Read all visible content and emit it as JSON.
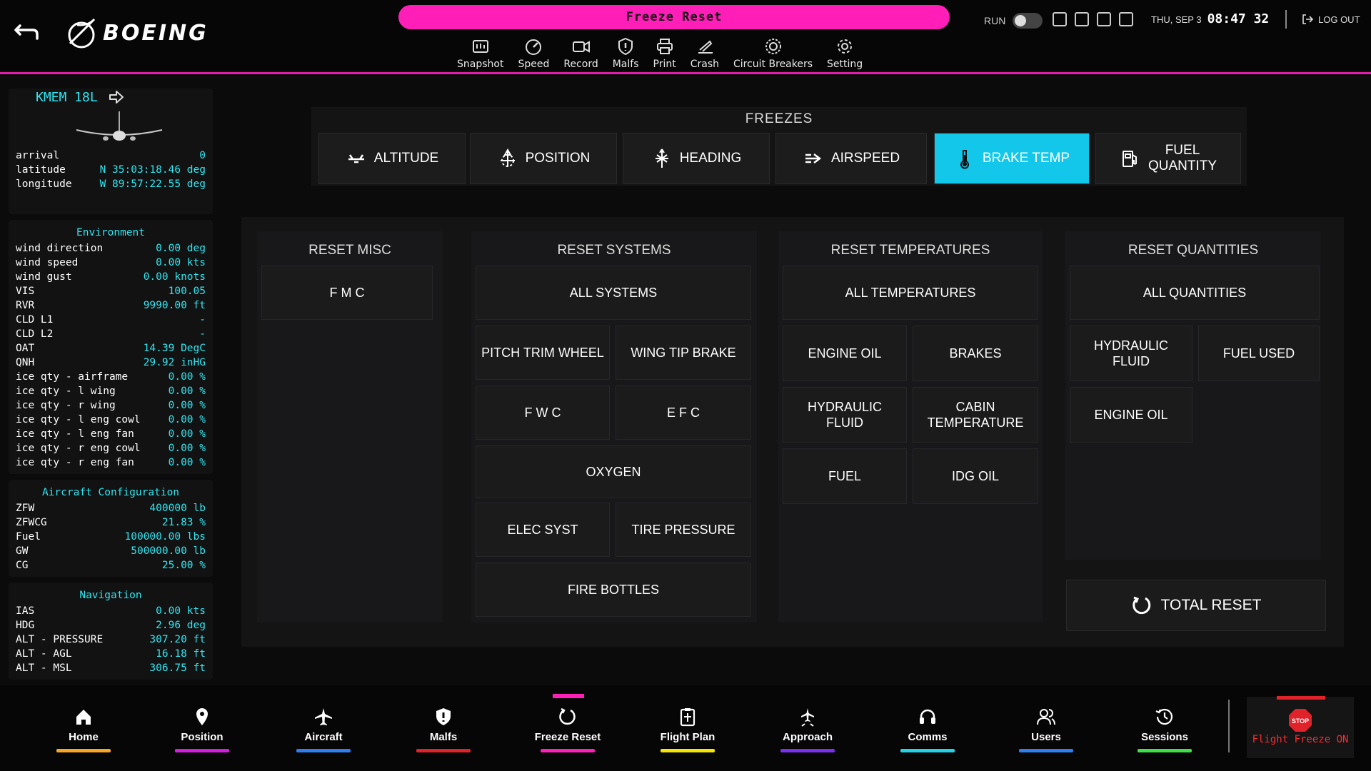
{
  "header": {
    "logo_text": "BOEING",
    "freeze_banner": "Freeze Reset",
    "toolbar": [
      {
        "label": "Snapshot",
        "icon": "snapshot-icon"
      },
      {
        "label": "Speed",
        "icon": "speed-icon"
      },
      {
        "label": "Record",
        "icon": "record-icon"
      },
      {
        "label": "Malfs",
        "icon": "malfs-icon"
      },
      {
        "label": "Print",
        "icon": "print-icon"
      },
      {
        "label": "Crash",
        "icon": "crash-icon"
      },
      {
        "label": "Circuit Breakers",
        "icon": "circuit-breakers-icon"
      },
      {
        "label": "Setting",
        "icon": "gear-icon"
      }
    ],
    "run_label": "RUN",
    "date": "THU, SEP 3",
    "time": "08:47 32",
    "logout_label": "LOG OUT"
  },
  "sidebar": {
    "airport": "KMEM 18L",
    "position": [
      {
        "k": "arrival",
        "v": "0"
      },
      {
        "k": "latitude",
        "v": "N 35:03:18.46 deg"
      },
      {
        "k": "longitude",
        "v": "W 89:57:22.55 deg"
      }
    ],
    "environment_title": "Environment",
    "environment": [
      {
        "k": "wind direction",
        "v": "0.00 deg"
      },
      {
        "k": "wind speed",
        "v": "0.00 kts"
      },
      {
        "k": "wind gust",
        "v": "0.00 knots"
      },
      {
        "k": "VIS",
        "v": "100.05"
      },
      {
        "k": "RVR",
        "v": "9990.00 ft"
      },
      {
        "k": "CLD L1",
        "v": "-"
      },
      {
        "k": "CLD L2",
        "v": "-"
      },
      {
        "k": "OAT",
        "v": "14.39 DegC"
      },
      {
        "k": "QNH",
        "v": "29.92 inHG"
      },
      {
        "k": "ice qty - airframe",
        "v": "0.00 %"
      },
      {
        "k": "ice qty - l wing",
        "v": "0.00 %"
      },
      {
        "k": "ice qty - r wing",
        "v": "0.00 %"
      },
      {
        "k": "ice qty - l eng cowl",
        "v": "0.00 %"
      },
      {
        "k": "ice qty - l eng fan",
        "v": "0.00 %"
      },
      {
        "k": "ice qty - r eng cowl",
        "v": "0.00 %"
      },
      {
        "k": "ice qty - r eng fan",
        "v": "0.00 %"
      }
    ],
    "config_title": "Aircraft Configuration",
    "config": [
      {
        "k": "ZFW",
        "v": "400000 lb"
      },
      {
        "k": "ZFWCG",
        "v": "21.83 %"
      },
      {
        "k": "Fuel",
        "v": "100000.00 lbs"
      },
      {
        "k": "GW",
        "v": "500000.00 lb"
      },
      {
        "k": "CG",
        "v": "25.00 %"
      }
    ],
    "nav_title": "Navigation",
    "navigation": [
      {
        "k": "IAS",
        "v": "0.00 kts"
      },
      {
        "k": "HDG",
        "v": "2.96 deg"
      },
      {
        "k": "ALT - PRESSURE",
        "v": "307.20 ft"
      },
      {
        "k": "ALT - AGL",
        "v": "16.18 ft"
      },
      {
        "k": "ALT - MSL",
        "v": "306.75 ft"
      }
    ]
  },
  "freezes": {
    "title": "FREEZES",
    "buttons": [
      "ALTITUDE",
      "POSITION",
      "HEADING",
      "AIRSPEED",
      "BRAKE TEMP",
      "FUEL\nQUANTITY"
    ],
    "active": "BRAKE TEMP",
    "active_color": "#13c7ea"
  },
  "reset_misc": {
    "title": "RESET MISC",
    "buttons": [
      "F M C"
    ]
  },
  "reset_systems": {
    "title": "RESET SYSTEMS",
    "buttons": [
      "ALL SYSTEMS",
      "PITCH TRIM WHEEL",
      "WING TIP BRAKE",
      "F W C",
      "E F C",
      "OXYGEN",
      "ELEC SYST",
      "TIRE PRESSURE",
      "FIRE BOTTLES"
    ]
  },
  "reset_temperatures": {
    "title": "RESET TEMPERATURES",
    "buttons": [
      "ALL TEMPERATURES",
      "ENGINE OIL",
      "BRAKES",
      "HYDRAULIC FLUID",
      "CABIN TEMPERATURE",
      "FUEL",
      "IDG OIL"
    ]
  },
  "reset_quantities": {
    "title": "RESET QUANTITIES",
    "buttons": [
      "ALL QUANTITIES",
      "HYDRAULIC FLUID",
      "FUEL USED",
      "ENGINE OIL"
    ]
  },
  "total_reset": "TOTAL RESET",
  "bottom_nav": [
    {
      "label": "Home",
      "icon": "home-icon",
      "color": "#f5a623"
    },
    {
      "label": "Position",
      "icon": "location-pin-icon",
      "color": "#d21ee0"
    },
    {
      "label": "Aircraft",
      "icon": "airplane-icon",
      "color": "#2f7df0"
    },
    {
      "label": "Malfs",
      "icon": "malfs-icon",
      "color": "#e0222a"
    },
    {
      "label": "Freeze Reset",
      "icon": "freeze-reset-icon",
      "color": "#ff1fb8"
    },
    {
      "label": "Flight Plan",
      "icon": "flight-plan-icon",
      "color": "#f5e400"
    },
    {
      "label": "Approach",
      "icon": "approach-icon",
      "color": "#7b2ff0"
    },
    {
      "label": "Comms",
      "icon": "headset-icon",
      "color": "#22d3e6"
    },
    {
      "label": "Users",
      "icon": "users-icon",
      "color": "#2f7df0"
    },
    {
      "label": "Sessions",
      "icon": "history-icon",
      "color": "#3ee04a"
    }
  ],
  "flight_freeze": {
    "stop_text": "STOP",
    "label": "Flight Freeze ON",
    "color": "#ff2a30"
  }
}
